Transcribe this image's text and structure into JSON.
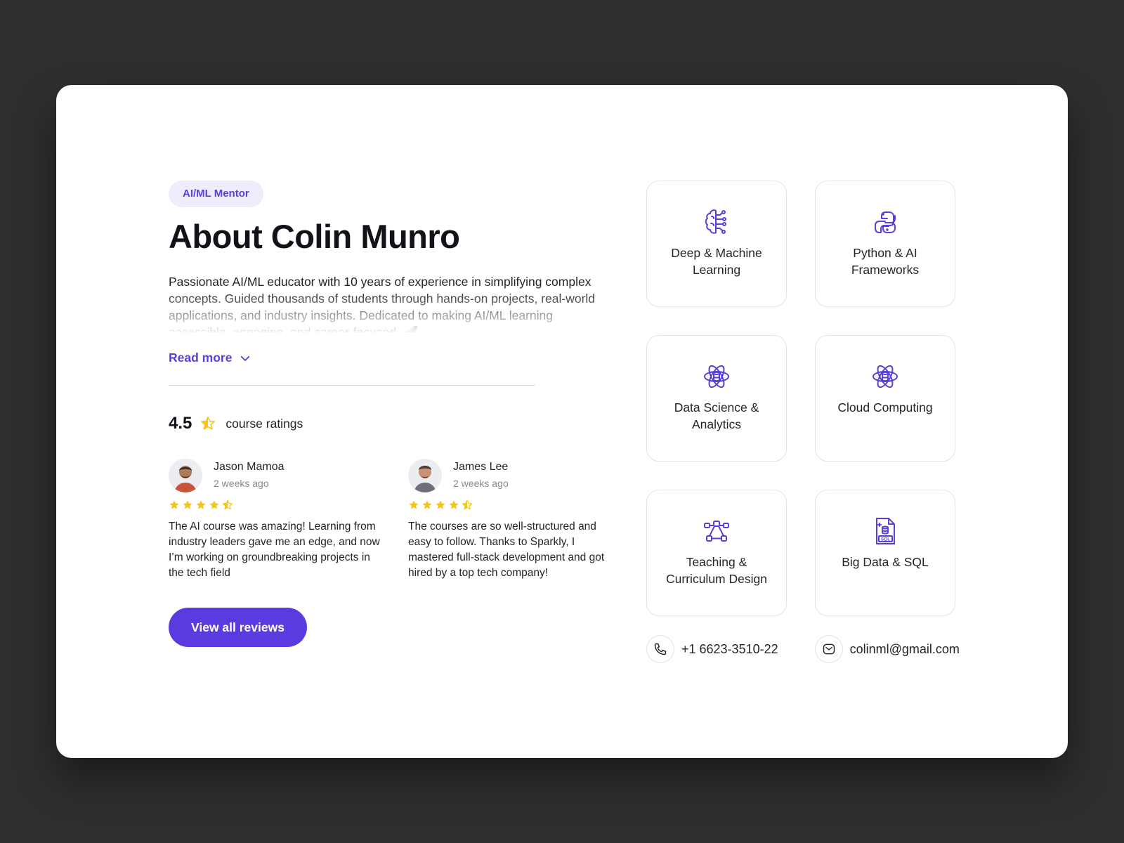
{
  "profile": {
    "badge": "AI/ML Mentor",
    "title": "About Colin Munro",
    "about": "Passionate AI/ML educator with 10 years of experience in simplifying complex concepts. Guided thousands of students through hands-on projects, real-world applications, and industry insights. Dedicated to making AI/ML learning accessible, engaging, and career-focused. 🚀",
    "read_more": "Read more"
  },
  "rating": {
    "score": "4.5",
    "caption": "course ratings",
    "star_color": "#f5c518"
  },
  "reviews": [
    {
      "name": "Jason Mamoa",
      "time": "2 weeks ago",
      "stars": 4.5,
      "text": "The AI course was amazing! Learning from industry leaders gave me an edge, and now I’m working on groundbreaking projects in the tech field"
    },
    {
      "name": "James Lee",
      "time": "2 weeks ago",
      "stars": 4.5,
      "text": "The courses are so well-structured and easy to follow. Thanks to Sparkly, I mastered full-stack development and got hired by a top tech company!"
    }
  ],
  "view_all_label": "View all reviews",
  "skills": [
    {
      "icon": "brain-circuit-icon",
      "label": "Deep & Machine Learning"
    },
    {
      "icon": "python-icon",
      "label": "Python & AI Frameworks"
    },
    {
      "icon": "atom-database-icon",
      "label": "Data Science & Analytics"
    },
    {
      "icon": "atom-database-icon",
      "label": "Cloud Computing"
    },
    {
      "icon": "workflow-nodes-icon",
      "label": "Teaching & Curriculum Design"
    },
    {
      "icon": "sql-file-icon",
      "label": "Big Data & SQL"
    }
  ],
  "contact": {
    "phone": "+1 6623-3510-22",
    "email": "colinml@gmail.com"
  },
  "colors": {
    "accent": "#5b3bdf",
    "badge_bg": "#efedfb",
    "background": "#2f2f2f"
  }
}
